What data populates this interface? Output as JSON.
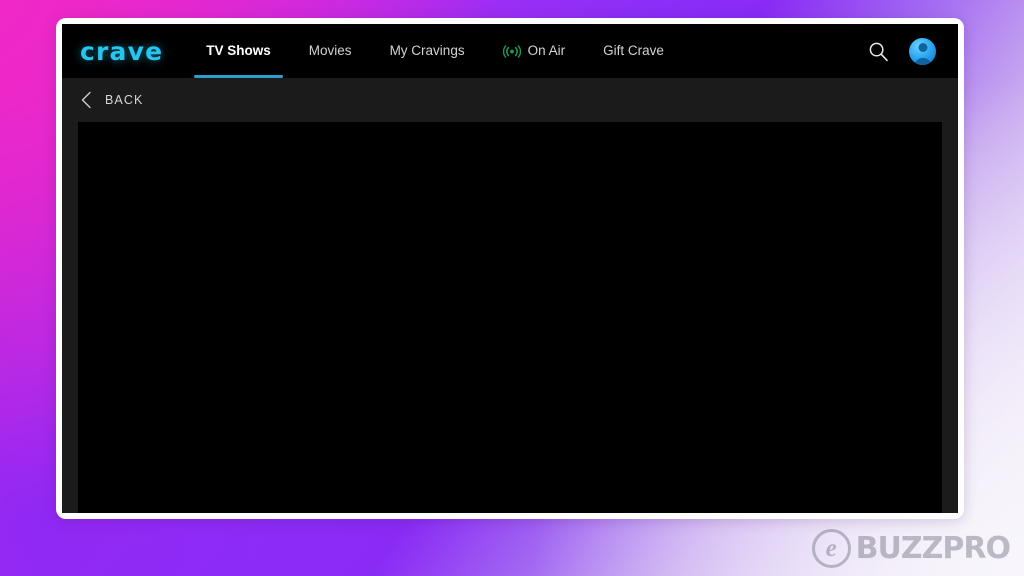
{
  "app": {
    "logo_text": "crave",
    "logo_color": "#25c6ef",
    "accent_underline_color": "#2e9ccd",
    "onair_icon_color": "#1f9d55",
    "surface_color": "#1b1b1b",
    "content_color": "#000000"
  },
  "nav": {
    "items": [
      {
        "label": "TV Shows",
        "active": true,
        "icon": null
      },
      {
        "label": "Movies",
        "active": false,
        "icon": null
      },
      {
        "label": "My Cravings",
        "active": false,
        "icon": null
      },
      {
        "label": "On Air",
        "active": false,
        "icon": "broadcast-icon"
      },
      {
        "label": "Gift Crave",
        "active": false,
        "icon": null
      }
    ]
  },
  "topbar_right": {
    "search_icon": "search-icon",
    "avatar_icon": "user-avatar-icon"
  },
  "backbar": {
    "chevron_icon": "chevron-left-icon",
    "label": "BACK"
  },
  "content": {
    "state": "blank"
  },
  "watermark": {
    "mark": "e",
    "text": "BUZZPRO"
  }
}
